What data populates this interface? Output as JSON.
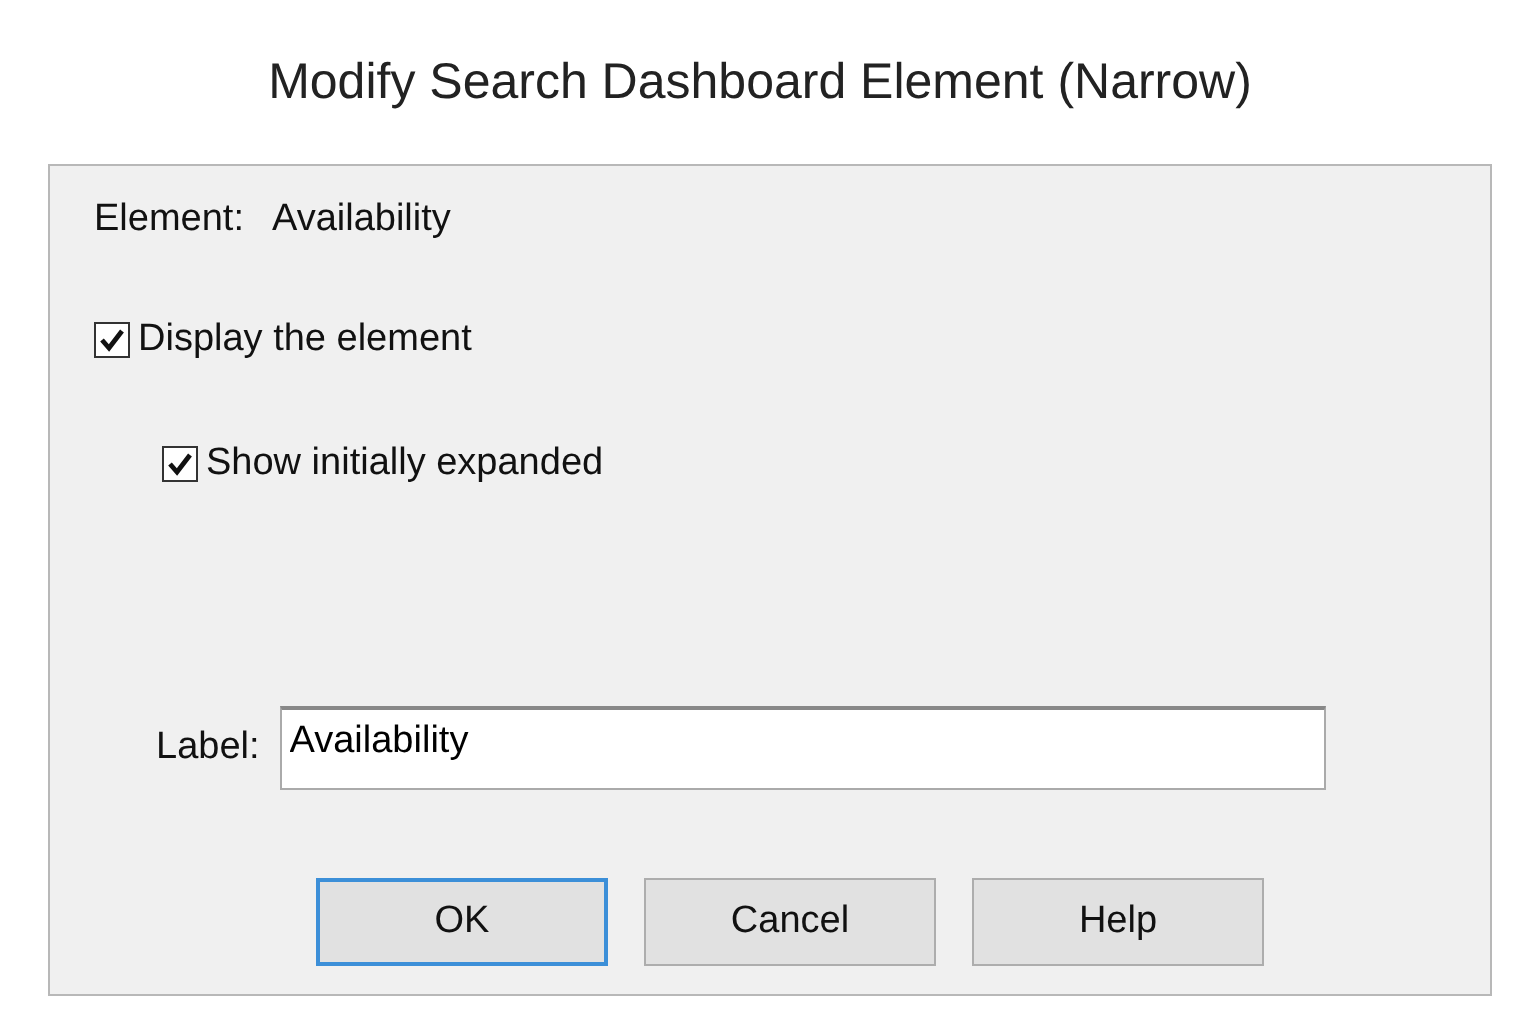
{
  "window": {
    "title": "Modify Search Dashboard Element (Narrow)"
  },
  "element": {
    "label": "Element:",
    "value": "Availability"
  },
  "options": [
    {
      "label": "Display the element",
      "checked": true
    },
    {
      "label": "Show initially expanded",
      "checked": true
    }
  ],
  "label_field": {
    "label": "Label:",
    "value": "Availability"
  },
  "buttons": [
    {
      "label": "OK",
      "selected": true
    },
    {
      "label": "Cancel",
      "selected": false
    },
    {
      "label": "Help",
      "selected": false
    }
  ]
}
